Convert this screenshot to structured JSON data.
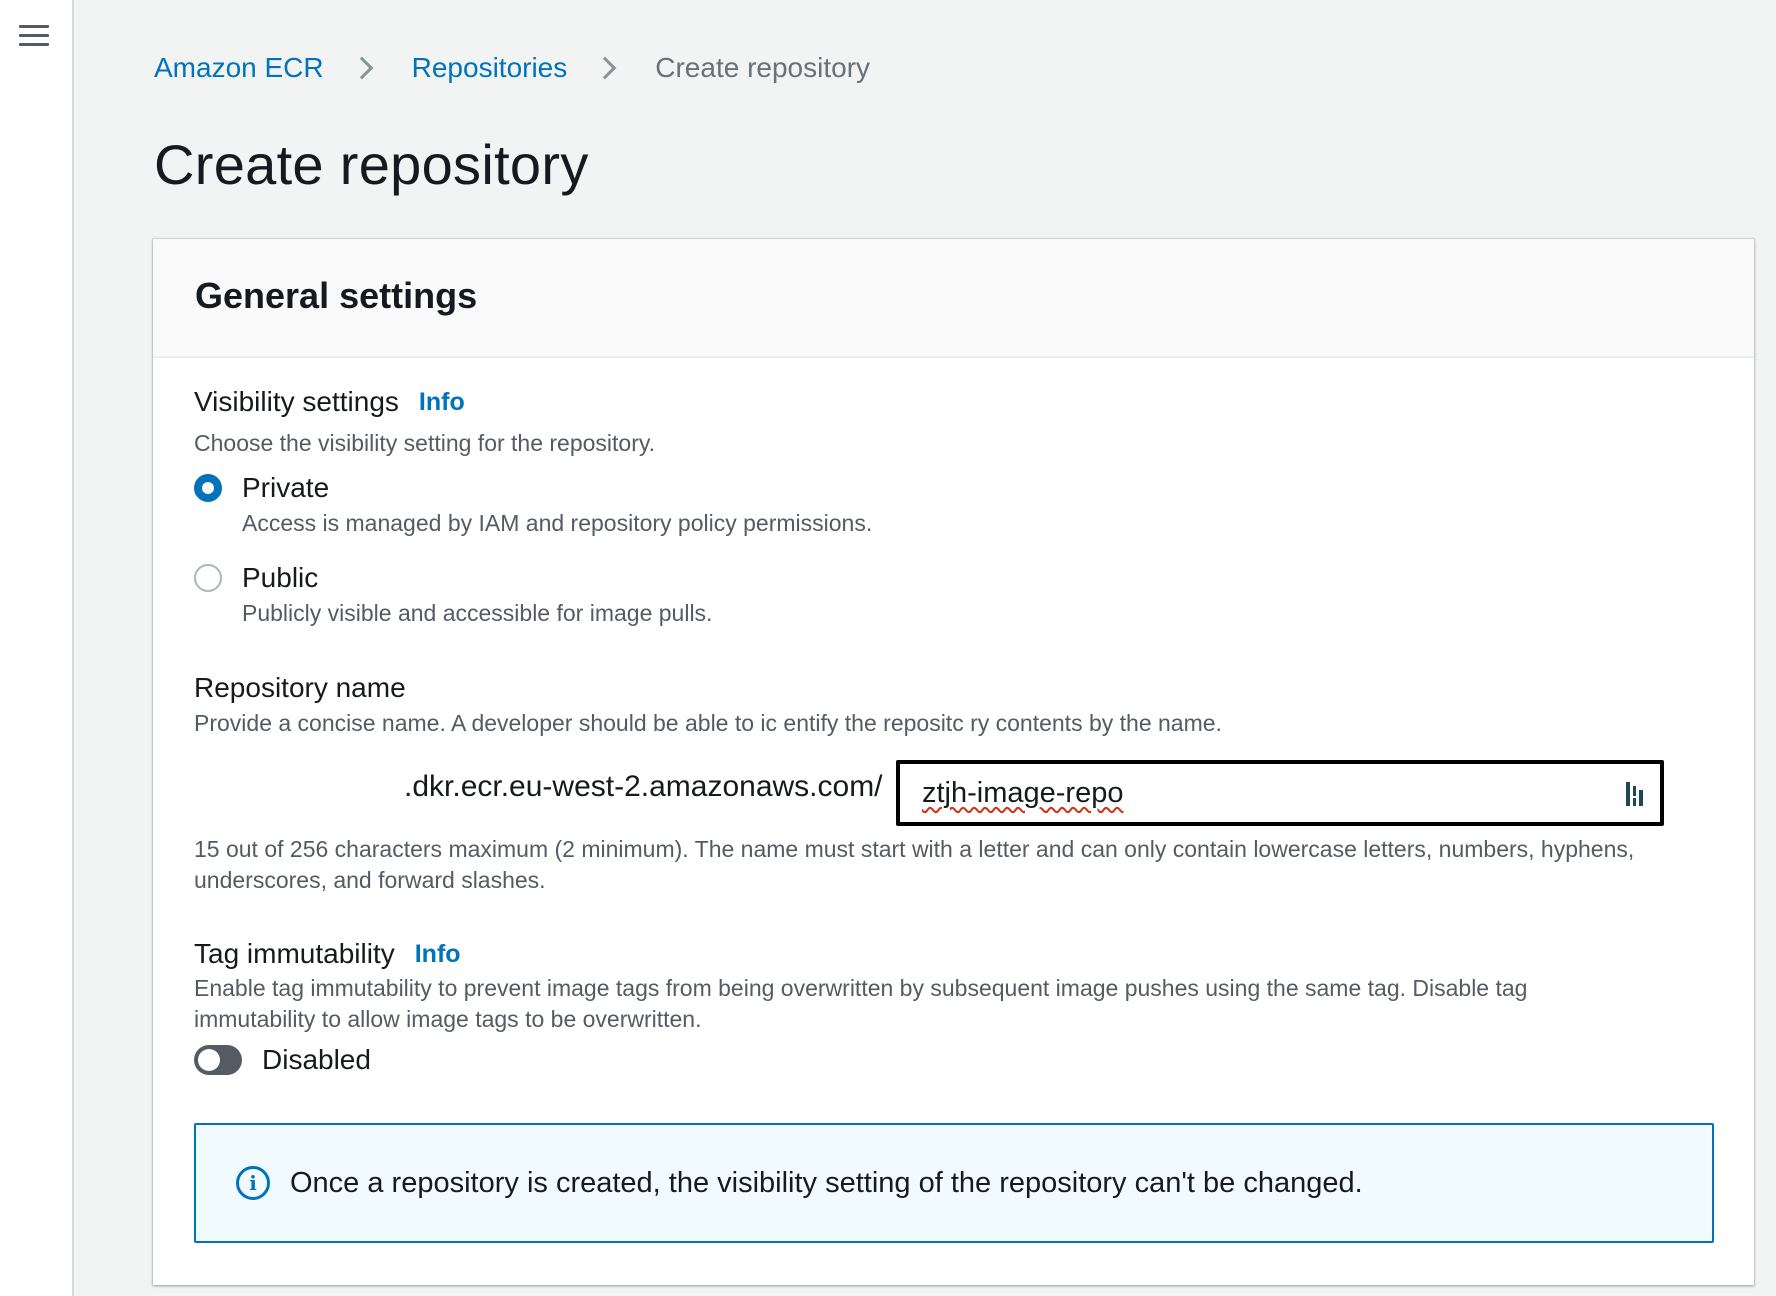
{
  "breadcrumb": {
    "items": [
      "Amazon ECR",
      "Repositories",
      "Create repository"
    ]
  },
  "page": {
    "title": "Create repository"
  },
  "general_settings": {
    "title": "General settings",
    "visibility": {
      "label": "Visibility settings",
      "info": "Info",
      "description": "Choose the visibility setting for the repository.",
      "selected": "Private",
      "options": [
        {
          "label": "Private",
          "description": "Access is managed by IAM and repository policy permissions."
        },
        {
          "label": "Public",
          "description": "Publicly visible and accessible for image pulls."
        }
      ]
    },
    "repository_name": {
      "label": "Repository name",
      "description": "Provide a concise name. A developer should be able to ic entify the repositc ry contents by the name.",
      "prefix": ".dkr.ecr.eu-west-2.amazonaws.com/",
      "value": "ztjh-image-repo",
      "constraint": "15 out of 256 characters maximum (2 minimum). The name must start with a letter and can only contain lowercase letters, numbers, hyphens, underscores, and forward slashes."
    },
    "tag_immutability": {
      "label": "Tag immutability",
      "info": "Info",
      "description": "Enable tag immutability to prevent image tags from being overwritten by subsequent image pushes using the same tag. Disable tag immutability to allow image tags to be overwritten.",
      "state": "Disabled",
      "enabled": false
    },
    "alert": {
      "icon": "info-circle-icon",
      "text": "Once a repository is created, the visibility setting of the repository can't be changed."
    }
  },
  "colors": {
    "link": "#0073bb",
    "page_bg": "#f2f3f3",
    "text_secondary": "#545b64",
    "alert_bg": "#f1faff"
  }
}
